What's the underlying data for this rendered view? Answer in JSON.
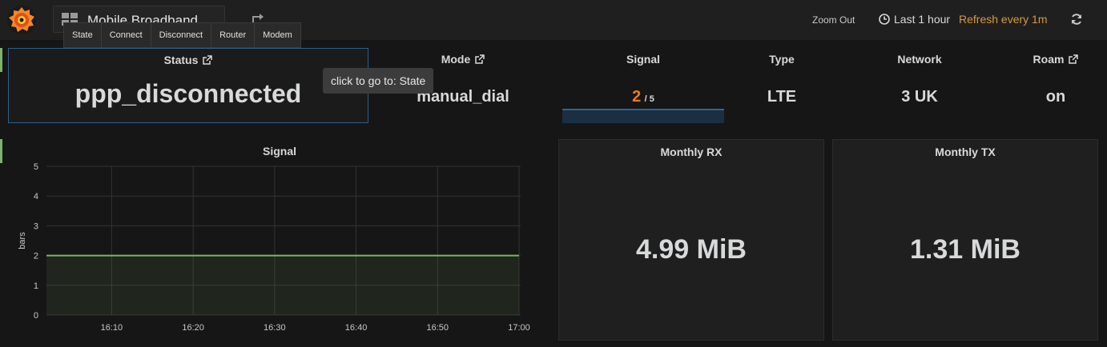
{
  "nav": {
    "dashboard_title": "Mobile Broadband",
    "zoom_out": "Zoom Out",
    "time_range": "Last 1 hour",
    "refresh": "Refresh every 1m"
  },
  "links": [
    "State",
    "Connect",
    "Disconnect",
    "Router",
    "Modem"
  ],
  "tooltip": "click to go to: State",
  "stats": {
    "status": {
      "title": "Status",
      "value": "ppp_disconnected"
    },
    "mode": {
      "title": "Mode",
      "value": "manual_dial"
    },
    "signal": {
      "title": "Signal",
      "value": "2",
      "suffix": "/ 5",
      "fraction": 0.4
    },
    "type": {
      "title": "Type",
      "value": "LTE"
    },
    "network": {
      "title": "Network",
      "value": "3 UK"
    },
    "roam": {
      "title": "Roam",
      "value": "on"
    }
  },
  "monthly_rx": {
    "title": "Monthly RX",
    "value": "4.99 MiB"
  },
  "monthly_tx": {
    "title": "Monthly TX",
    "value": "1.31 MiB"
  },
  "colors": {
    "accent": "#d69a3b",
    "series": "#7eb26d",
    "value_orange": "#eb7b18",
    "panel_border_active": "#2f5f8a"
  },
  "chart_data": {
    "type": "area",
    "title": "Signal",
    "ylabel": "bars",
    "xlabel": "",
    "ylim": [
      0,
      5
    ],
    "yticks": [
      "0",
      "1",
      "2",
      "3",
      "4",
      "5"
    ],
    "xticks": [
      "16:10",
      "16:20",
      "16:30",
      "16:40",
      "16:50",
      "17:00"
    ],
    "x": [
      "16:02",
      "17:00"
    ],
    "series": [
      {
        "values": [
          2,
          2
        ]
      }
    ],
    "grid": true
  }
}
